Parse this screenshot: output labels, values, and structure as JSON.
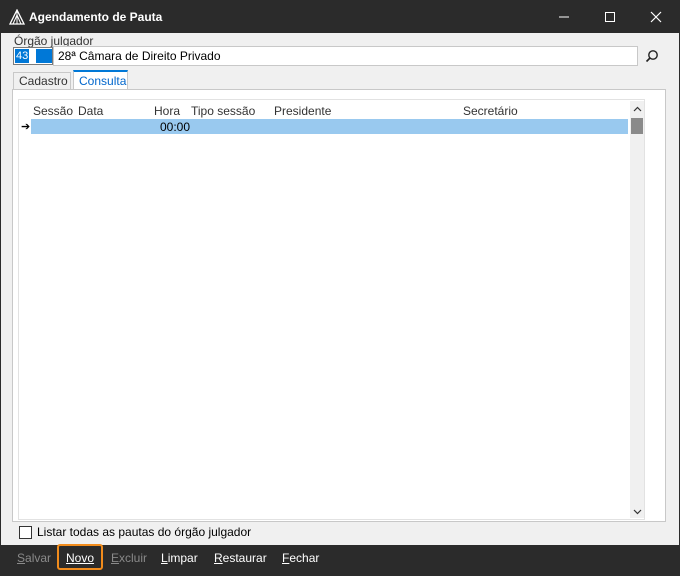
{
  "window": {
    "title": "Agendamento de Pauta",
    "icons": {
      "app": "tent-logo-icon",
      "minimize": "minimize-icon",
      "maximize": "maximize-icon",
      "close": "close-icon"
    }
  },
  "orgao": {
    "label": "Órgão julgador",
    "code": "43",
    "name": "28ª Câmara de Direito Privado",
    "search_icon": "search-icon"
  },
  "tabs": [
    {
      "label": "Cadastro",
      "active": false
    },
    {
      "label": "Consulta",
      "active": true
    }
  ],
  "grid": {
    "columns": [
      "Sessão",
      "Data",
      "Hora",
      "Tipo sessão",
      "Presidente",
      "Secretário"
    ],
    "rows": [
      {
        "sessao": "",
        "data": "",
        "hora": "00:00",
        "tipo": "",
        "presidente": "",
        "secretario": ""
      }
    ],
    "row_indicator": "➔"
  },
  "options": {
    "listar_todas_label": "Listar todas as pautas do órgão julgador",
    "listar_todas_checked": false
  },
  "toolbar": {
    "salvar": {
      "first": "S",
      "rest": "alvar",
      "enabled": false
    },
    "novo": {
      "first": "N",
      "rest": "ovo",
      "enabled": true
    },
    "excluir": {
      "first": "E",
      "rest": "xcluir",
      "enabled": false
    },
    "limpar": {
      "first": "L",
      "rest": "impar",
      "enabled": true
    },
    "restaurar": {
      "first": "R",
      "rest": "estaurar",
      "enabled": true
    },
    "fechar": {
      "first": "F",
      "rest": "echar",
      "enabled": true
    }
  },
  "colors": {
    "titlebar": "#2b2b2b",
    "accent": "#0078d7",
    "selected_row": "#99c9ef",
    "highlight_box": "#f28c1c"
  }
}
